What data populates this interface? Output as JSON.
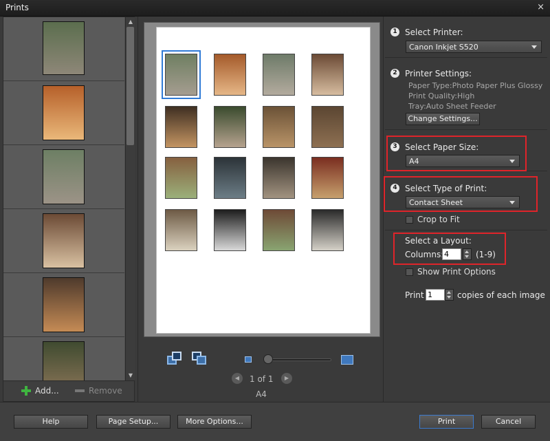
{
  "window": {
    "title": "Prints",
    "close_symbol": "×"
  },
  "left_panel": {
    "thumbnails": [
      {
        "colors": [
          "#5b6e4e",
          "#8e8778"
        ]
      },
      {
        "colors": [
          "#b6602a",
          "#eab87a"
        ]
      },
      {
        "colors": [
          "#6d7f64",
          "#9c9387"
        ]
      },
      {
        "colors": [
          "#6b4a35",
          "#d9c1a2"
        ]
      },
      {
        "colors": [
          "#4e3a2c",
          "#c58b55"
        ]
      },
      {
        "colors": [
          "#3f4b30",
          "#8d7659"
        ]
      }
    ],
    "add_label": "Add...",
    "remove_label": "Remove"
  },
  "preview": {
    "photos": [
      {
        "colors": [
          "#6f7f62",
          "#a59d90"
        ],
        "selected": true
      },
      {
        "colors": [
          "#a45a2a",
          "#e6b787"
        ],
        "selected": false
      },
      {
        "colors": [
          "#6e7b69",
          "#b3ab9e"
        ],
        "selected": false
      },
      {
        "colors": [
          "#6b4a35",
          "#d7bda0"
        ],
        "selected": false
      },
      {
        "colors": [
          "#3f2f22",
          "#c39462"
        ],
        "selected": false
      },
      {
        "colors": [
          "#3a4b2e",
          "#b5a28e"
        ],
        "selected": false
      },
      {
        "colors": [
          "#6b5237",
          "#b99468"
        ],
        "selected": false
      },
      {
        "colors": [
          "#5b4632",
          "#8e7052"
        ],
        "selected": false
      },
      {
        "colors": [
          "#86603f",
          "#9bb07a"
        ],
        "selected": false
      },
      {
        "colors": [
          "#2c3338",
          "#6c7d86"
        ],
        "selected": false
      },
      {
        "colors": [
          "#3b352e",
          "#a29380"
        ],
        "selected": false
      },
      {
        "colors": [
          "#7a2d20",
          "#c6a06d"
        ],
        "selected": false
      },
      {
        "colors": [
          "#6d5a45",
          "#dbd2bf"
        ],
        "selected": false
      },
      {
        "colors": [
          "#1d1d1d",
          "#d9d9d9"
        ],
        "selected": false
      },
      {
        "colors": [
          "#6e4a36",
          "#89a471"
        ],
        "selected": false
      },
      {
        "colors": [
          "#2a2a2a",
          "#d5d1c8"
        ],
        "selected": false
      }
    ],
    "page_indicator": "1 of 1",
    "paper_label": "A4"
  },
  "settings": {
    "step1": {
      "number": "1",
      "title": "Select Printer:",
      "value": "Canon Inkjet S520"
    },
    "step2": {
      "number": "2",
      "title": "Printer Settings:",
      "lines": [
        "Paper Type:Photo Paper Plus Glossy",
        "Print Quality:High",
        "Tray:Auto Sheet Feeder"
      ],
      "button": "Change Settings..."
    },
    "step3": {
      "number": "3",
      "title": "Select Paper Size:",
      "value": "A4"
    },
    "step4": {
      "number": "4",
      "title": "Select Type of Print:",
      "value": "Contact Sheet"
    },
    "crop_to_fit": "Crop to Fit",
    "layout": {
      "title": "Select a Layout:",
      "columns_label": "Columns:",
      "columns_value": "4",
      "columns_range": "(1-9)"
    },
    "show_print_options": "Show Print Options",
    "print_label": "Print",
    "copies_value": "1",
    "copies_suffix": "copies of each image"
  },
  "bottom": {
    "help": "Help",
    "page_setup": "Page Setup...",
    "more_options": "More Options...",
    "print": "Print",
    "cancel": "Cancel"
  },
  "colors": {
    "highlight": "#e0242a",
    "accent": "#2f7ad6"
  }
}
